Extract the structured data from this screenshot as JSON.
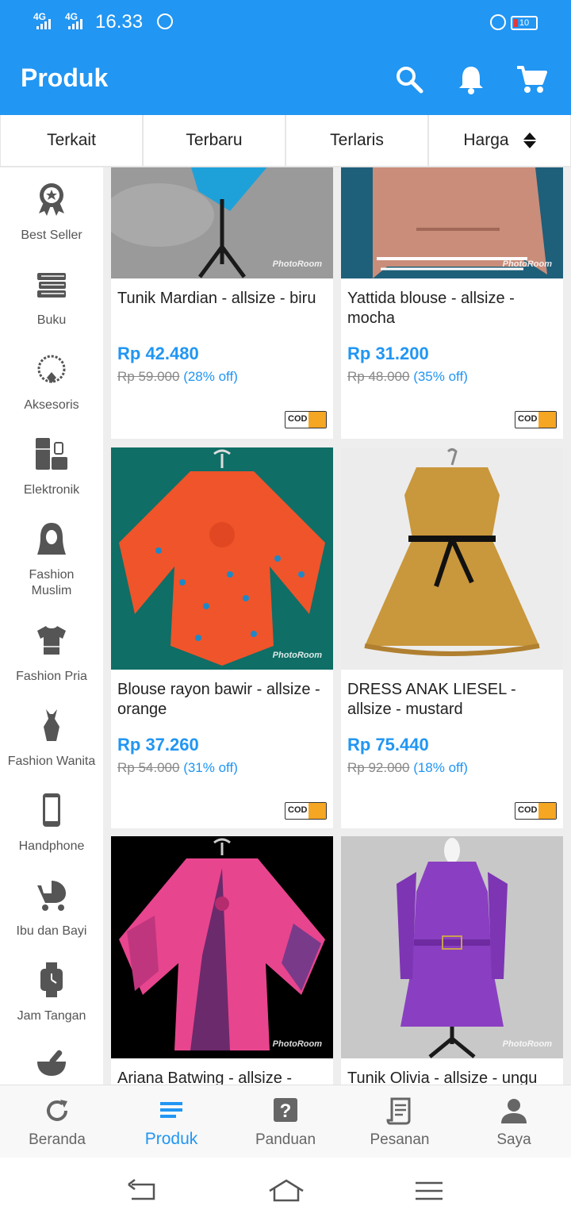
{
  "status_bar": {
    "network_1": "4G",
    "network_2": "4G",
    "time": "16.33",
    "battery": "10"
  },
  "app_bar": {
    "title": "Produk",
    "icons": [
      "search-icon",
      "bell-icon",
      "cart-icon"
    ]
  },
  "sort_tabs": [
    {
      "label": "Terkait"
    },
    {
      "label": "Terbaru"
    },
    {
      "label": "Terlaris"
    },
    {
      "label": "Harga",
      "icon": "sort-updown-icon"
    }
  ],
  "categories": [
    {
      "label": "Best Seller",
      "icon": "best-seller-badge-icon"
    },
    {
      "label": "Buku",
      "icon": "books-icon"
    },
    {
      "label": "Aksesoris",
      "icon": "necklace-icon"
    },
    {
      "label": "Elektronik",
      "icon": "electronics-icon"
    },
    {
      "label": "Fashion Muslim",
      "icon": "hijab-icon"
    },
    {
      "label": "Fashion Pria",
      "icon": "tshirt-icon"
    },
    {
      "label": "Fashion Wanita",
      "icon": "dress-icon"
    },
    {
      "label": "Handphone",
      "icon": "smartphone-icon"
    },
    {
      "label": "Ibu dan Bayi",
      "icon": "stroller-icon"
    },
    {
      "label": "Jam Tangan",
      "icon": "watch-icon"
    },
    {
      "label": "",
      "icon": "mortar-pestle-icon"
    }
  ],
  "products": [
    {
      "name": "Tunik Mardian - allsize - biru",
      "price": "Rp 42.480",
      "original_price": "Rp 59.000",
      "discount": "(28% off)",
      "cod": "COD",
      "watermark": "PhotoRoom",
      "colors": {
        "bg": "#9a9a9a",
        "item": "#1ea1d9"
      }
    },
    {
      "name": "Yattida blouse - allsize - mocha",
      "price": "Rp 31.200",
      "original_price": "Rp 48.000",
      "discount": "(35% off)",
      "cod": "COD",
      "watermark": "PhotoRoom",
      "colors": {
        "bg": "#1e5f7a",
        "item": "#c98d7a"
      }
    },
    {
      "name": "Blouse rayon bawir - allsize - orange",
      "price": "Rp 37.260",
      "original_price": "Rp 54.000",
      "discount": "(31% off)",
      "cod": "COD",
      "watermark": "PhotoRoom",
      "colors": {
        "bg": "#0f6e66",
        "item": "#f0542a"
      }
    },
    {
      "name": "DRESS ANAK LIESEL  - allsize - mustard",
      "price": "Rp 75.440",
      "original_price": "Rp 92.000",
      "discount": "(18% off)",
      "cod": "COD",
      "watermark": "",
      "colors": {
        "bg": "#ececec",
        "item": "#c9973c"
      }
    },
    {
      "name": "Ariana Batwing - allsize -",
      "price": "",
      "original_price": "",
      "discount": "",
      "cod": "",
      "watermark": "PhotoRoom",
      "colors": {
        "bg": "#000000",
        "item": "#e8458f"
      }
    },
    {
      "name": "Tunik Olivia - allsize - ungu",
      "price": "",
      "original_price": "",
      "discount": "",
      "cod": "",
      "watermark": "PhotoRoom",
      "colors": {
        "bg": "#c8c8c8",
        "item": "#8a3fc2"
      }
    }
  ],
  "bottom_nav": [
    {
      "label": "Beranda",
      "icon": "refresh-icon"
    },
    {
      "label": "Produk",
      "icon": "list-icon",
      "active": true
    },
    {
      "label": "Panduan",
      "icon": "help-icon"
    },
    {
      "label": "Pesanan",
      "icon": "receipt-icon"
    },
    {
      "label": "Saya",
      "icon": "person-icon"
    }
  ],
  "accent_color": "#2196f3"
}
